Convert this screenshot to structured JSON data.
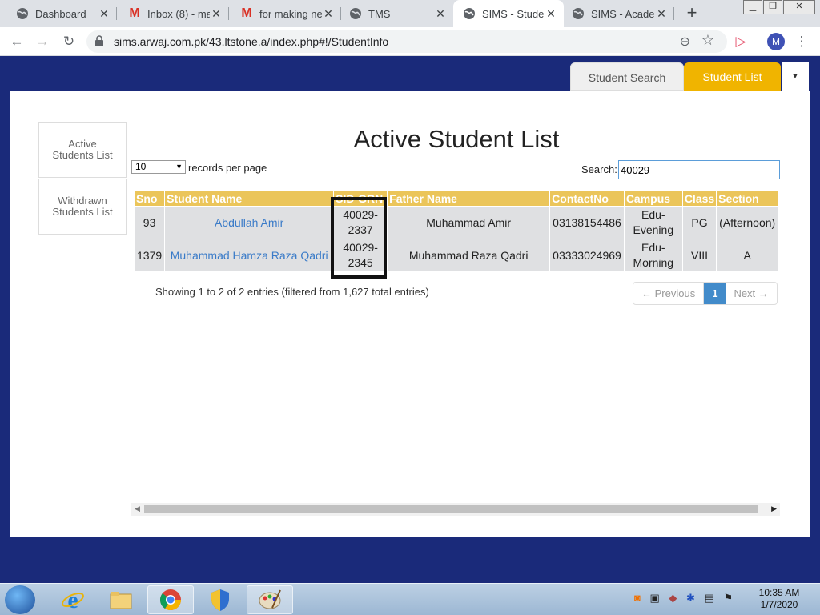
{
  "browser": {
    "tabs": [
      {
        "title": "Dashboard",
        "icon": "globe-icon"
      },
      {
        "title": "Inbox (8) - ma",
        "icon": "gmail-icon"
      },
      {
        "title": "for making ne",
        "icon": "gmail-icon"
      },
      {
        "title": "TMS",
        "icon": "globe-icon"
      },
      {
        "title": "SIMS - Studen",
        "icon": "globe-icon",
        "active": true
      },
      {
        "title": "SIMS - Acade",
        "icon": "globe-icon"
      }
    ],
    "url": "sims.arwaj.com.pk/43.ltstone.a/index.php#!/StudentInfo",
    "profile_initial": "M"
  },
  "nav": {
    "student_search": "Student Search",
    "student_list": "Student List"
  },
  "sidebar": {
    "active": "Active Students List",
    "withdrawn": "Withdrawn Students List"
  },
  "main": {
    "title": "Active Student List",
    "length_value": "10",
    "records_per_page": "records per page",
    "search_label": "Search:",
    "search_value": "40029",
    "columns": [
      "Sno",
      "Student Name",
      "SID-GRN",
      "Father Name",
      "ContactNo",
      "Campus",
      "Class",
      "Section"
    ],
    "rows": [
      {
        "sno": "93",
        "name": "Abdullah Amir",
        "sid1": "40029-",
        "sid2": "2337",
        "father": "Muhammad Amir",
        "contact": "03138154486",
        "campus1": "Edu-",
        "campus2": "Evening",
        "class": "PG",
        "section": "(Afternoon)"
      },
      {
        "sno": "1379",
        "name": "Muhammad Hamza Raza Qadri",
        "sid1": "40029-",
        "sid2": "2345",
        "father": "Muhammad Raza Qadri",
        "contact": "03333024969",
        "campus1": "Edu-",
        "campus2": "Morning",
        "class": "VIII",
        "section": "A"
      }
    ],
    "info": "Showing 1 to 2 of 2 entries (filtered from 1,627 total entries)",
    "pager": {
      "prev": "← Previous",
      "current": "1",
      "next": "Next →"
    }
  },
  "taskbar": {
    "time": "10:35 AM",
    "date": "1/7/2020"
  },
  "colors": {
    "page_bg": "#1a2a7a",
    "accent": "#f0b400",
    "header": "#ebc55a",
    "link": "#3a7bc8"
  }
}
